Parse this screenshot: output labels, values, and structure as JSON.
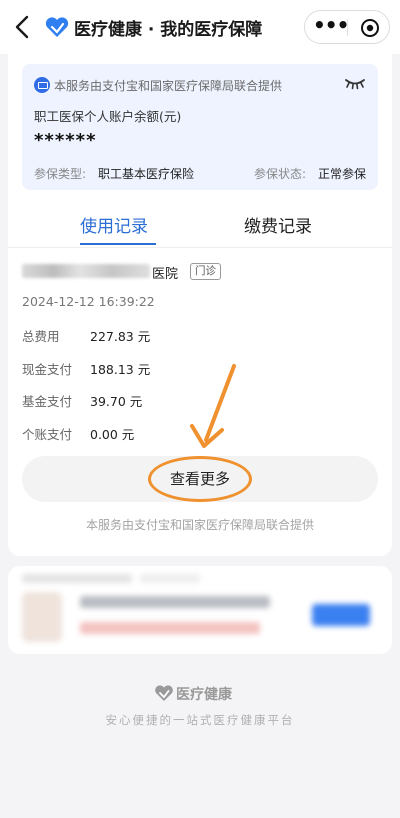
{
  "header": {
    "title": "医疗健康 · 我的医疗保障",
    "more_label": "•••"
  },
  "account": {
    "provider_text": "本服务由支付宝和国家医疗保障局联合提供",
    "balance_label": "职工医保个人账户余额(元)",
    "balance_value": "******",
    "type_label": "参保类型:",
    "type_value": "职工基本医疗保险",
    "status_label": "参保状态:",
    "status_value": "正常参保"
  },
  "tabs": {
    "usage": "使用记录",
    "payment": "缴费记录",
    "active": "usage"
  },
  "record": {
    "hospital_suffix": "医院",
    "badge": "门诊",
    "datetime": "2024-12-12 16:39:22",
    "rows": [
      {
        "label": "总费用",
        "value": "227.83 元"
      },
      {
        "label": "现金支付",
        "value": "188.13 元"
      },
      {
        "label": "基金支付",
        "value": "39.70 元"
      },
      {
        "label": "个账支付",
        "value": "0.00 元"
      }
    ]
  },
  "more_button": "查看更多",
  "footnote": "本服务由支付宝和国家医疗保障局联合提供",
  "footer": {
    "brand": "医疗健康",
    "slogan": "安心便捷的一站式医疗健康平台"
  },
  "colors": {
    "accent": "#2c6ed5",
    "annotation": "#f0912f",
    "account_bg": "#eef3ff"
  }
}
